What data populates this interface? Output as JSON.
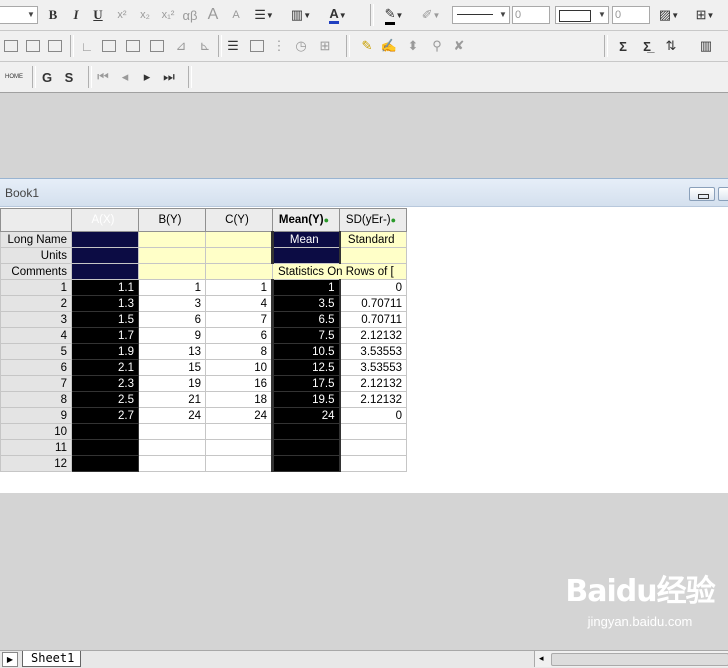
{
  "toolbar1": {
    "bold": "B",
    "italic": "I",
    "underline": "U",
    "superscript": "x²",
    "subscript": "x₂",
    "supersub": "x₁²",
    "greek": "αβ",
    "grow_font": "A",
    "shrink_font": "A",
    "line_width_value": "0",
    "line_width2_value": "0"
  },
  "toolbar3": {
    "g_label": "G",
    "s_label": "S",
    "home_label": "HOME"
  },
  "book": {
    "title": "Book1"
  },
  "columns": [
    {
      "label": "A(X)"
    },
    {
      "label": "B(Y)"
    },
    {
      "label": "C(Y)"
    },
    {
      "label": "Mean(Y)"
    },
    {
      "label": "SD(yEr-)"
    }
  ],
  "meta_rows": [
    {
      "label": "Long Name",
      "values": [
        "",
        "",
        "",
        "Mean",
        "Standard"
      ]
    },
    {
      "label": "Units",
      "values": [
        "",
        "",
        "",
        "",
        ""
      ]
    },
    {
      "label": "Comments",
      "values": [
        "",
        "",
        "",
        "Statistics On Rows of [",
        ""
      ]
    }
  ],
  "rows": [
    {
      "n": "1",
      "values": [
        "1.1",
        "1",
        "1",
        "1",
        "0"
      ]
    },
    {
      "n": "2",
      "values": [
        "1.3",
        "3",
        "4",
        "3.5",
        "0.70711"
      ]
    },
    {
      "n": "3",
      "values": [
        "1.5",
        "6",
        "7",
        "6.5",
        "0.70711"
      ]
    },
    {
      "n": "4",
      "values": [
        "1.7",
        "9",
        "6",
        "7.5",
        "2.12132"
      ]
    },
    {
      "n": "5",
      "values": [
        "1.9",
        "13",
        "8",
        "10.5",
        "3.53553"
      ]
    },
    {
      "n": "6",
      "values": [
        "2.1",
        "15",
        "10",
        "12.5",
        "3.53553"
      ]
    },
    {
      "n": "7",
      "values": [
        "2.3",
        "19",
        "16",
        "17.5",
        "2.12132"
      ]
    },
    {
      "n": "8",
      "values": [
        "2.5",
        "21",
        "18",
        "19.5",
        "2.12132"
      ]
    },
    {
      "n": "9",
      "values": [
        "2.7",
        "24",
        "24",
        "24",
        "0"
      ]
    },
    {
      "n": "10",
      "values": [
        "",
        "",
        "",
        "",
        ""
      ]
    },
    {
      "n": "11",
      "values": [
        "",
        "",
        "",
        "",
        ""
      ]
    },
    {
      "n": "12",
      "values": [
        "",
        "",
        "",
        "",
        ""
      ]
    }
  ],
  "sheet_tab": {
    "label": "Sheet1"
  },
  "watermark": {
    "logo": "Baidu经验",
    "url": "jingyan.baidu.com"
  }
}
